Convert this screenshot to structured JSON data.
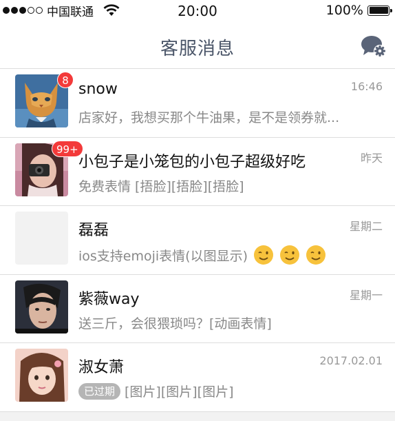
{
  "status_bar": {
    "carrier": "中国联通",
    "time": "20:00",
    "battery": "100%",
    "battery_level": 1.0
  },
  "nav": {
    "title": "客服消息"
  },
  "conversations": [
    {
      "name": "snow",
      "time": "16:46",
      "badge": "8",
      "message": "店家好，我想买那个牛油果，是不是领券就..."
    },
    {
      "name": "小包子是小笼包的小包子超级好吃",
      "time": "昨天",
      "badge": "99+",
      "message": "免费表情 [捂脸][捂脸][捂脸]"
    },
    {
      "name": "磊磊",
      "time": "星期二",
      "message": "ios支持emoji表情(以图显示)"
    },
    {
      "name": "紫薇way",
      "time": "星期一",
      "message": "送三斤，会很猥琐吗？[动画表情]"
    },
    {
      "name": "淑女萧",
      "time": "2017.02.01",
      "tag": "已过期",
      "message": "[图片][图片][图片]"
    }
  ],
  "icons": {
    "signal": "signal-dots-icon",
    "wifi": "wifi-icon",
    "battery": "battery-icon",
    "settings": "chat-settings-icon",
    "emoji": "wink-emoji-icon"
  }
}
